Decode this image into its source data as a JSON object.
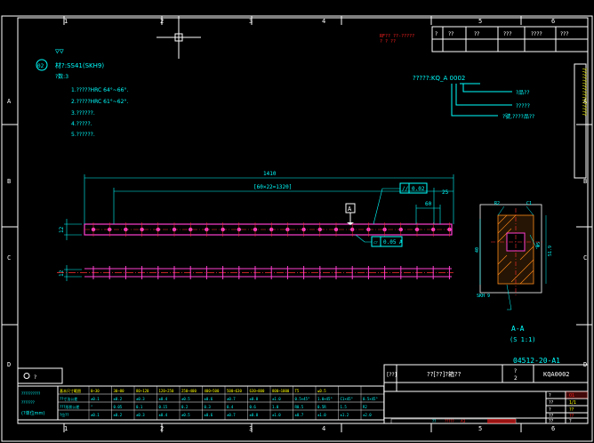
{
  "colors": {
    "background": "#000000",
    "border": "#ffffff",
    "part": "#ff3fd0",
    "dimension": "#00ffff",
    "note": "#00ffff",
    "stamp": "#ff2020",
    "highlight": "#ffff00",
    "hatch": "#ff8a1a",
    "centerline": "#ff3030",
    "table": "#00ffff",
    "table_header": "#ffff00"
  },
  "grid": {
    "top_columns": [
      "1",
      "2",
      "3",
      "4",
      "5",
      "6"
    ],
    "bottom_columns": [
      "1",
      "2",
      "3",
      "4",
      "5",
      "6"
    ],
    "left_rows": [
      "A",
      "B",
      "C",
      "D"
    ],
    "right_rows": [
      "A",
      "B",
      "C",
      "D"
    ]
  },
  "revision_block": {
    "stamp_line1": "RF?? ??-?????",
    "stamp_line2": "? ? ??",
    "headers": [
      "?",
      "?? ",
      "?? ",
      "??? ",
      "???? ",
      "??? "
    ]
  },
  "notes": {
    "roughness": "▽▽",
    "balloon_id": "02",
    "material": "材?:SS41(SKH9)",
    "qty": "?数:3",
    "items": [
      "1.?????HRC 64°~66°.",
      "2.?????HRC 61°~62°.",
      "3.??????.",
      "4.?????.",
      "5.??????."
    ]
  },
  "part_code": {
    "label": "?????:KQ_A 0002",
    "callouts": [
      "?品??",
      "?????",
      "?號,????品??"
    ]
  },
  "side_note": "?????????????????",
  "dimensions": {
    "overall": "1410",
    "pitch": "[60×22=1320]",
    "end_offset": "25",
    "pitch_small": "60",
    "height": "12",
    "height2": "12",
    "left_ref": "7"
  },
  "tolerances": {
    "parallel_symbol": "//",
    "parallel_value": "0.02",
    "flat_symbol": "⏥",
    "flat_value": "0.05 A",
    "datum": "A"
  },
  "section": {
    "dim_top": "R2",
    "dim_chamfer": "C1",
    "dim_width": "40",
    "dim_hole": "Φ5",
    "dim_right": "51.9",
    "dim_bottom": "SKH 9",
    "label": "A-A",
    "scale": "(S 1:1)"
  },
  "drawing_number": "04512-20-A1",
  "title_block": {
    "title_prefix": "[??]",
    "title": "??[??]?箱??",
    "qty_label": "?",
    "qty_value": "2",
    "code": "KQA0002",
    "rev_labels": [
      "?",
      "??",
      "?",
      "??",
      "??"
    ],
    "rev_values": [
      "01",
      "1/1",
      "??",
      "??",
      "?"
    ],
    "bottom_cells": [
      "??",
      "?????",
      "",
      "A3",
      ""
    ],
    "bottom_right": [
      "??",
      "A",
      "",
      ""
    ]
  },
  "general_tolerance": {
    "title": "??????  ???? 1?mm?",
    "headers": [
      "基本尺寸範囲",
      "0~30",
      "30~80",
      "80~120",
      "120~250",
      "250~400",
      "400~500",
      "500~630",
      "630~800",
      "800~1000",
      "T5",
      "≤0.5"
    ],
    "row1_label": "??寸法公差",
    "row1": [
      "±0.1",
      "±0.2",
      "±0.3",
      "±0.4",
      "±0.5",
      "±0.6",
      "±0.7",
      "±0.8",
      "±1.0",
      "0.5×45°",
      "1.0×45°",
      "C1×45°",
      "0.5×45°"
    ],
    "row2_label": "???形状公差",
    "row2": [
      "°",
      "0.05",
      "0.1",
      "0.15",
      "0.2",
      "0.3",
      "0.4",
      "0.6",
      "1.0",
      "R0.5",
      "0.5R",
      "1.5",
      "R2"
    ],
    "row3_label": "?位??",
    "row3": [
      "±0.1",
      "±0.2",
      "±0.3",
      "±0.4",
      "±0.5",
      "±0.6",
      "±0.7",
      "±0.8",
      "±1.0",
      "±0.7",
      "±1.0",
      "±1.2",
      "±2.0"
    ],
    "left_labels": [
      "??????????",
      "???????",
      "(?单位mm)"
    ]
  },
  "projection": {
    "label": "?"
  }
}
